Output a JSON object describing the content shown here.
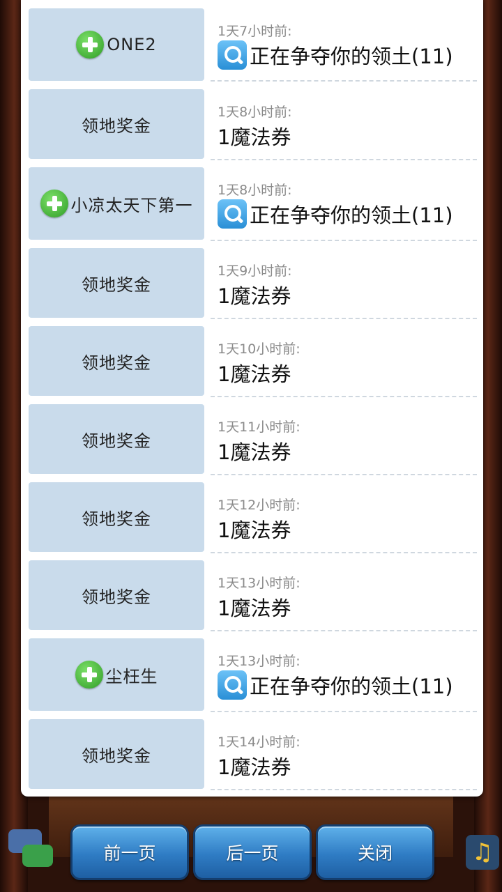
{
  "rows": [
    {
      "left": {
        "icon": "plus-icon",
        "text": "ONE2"
      },
      "time": "1天7小时前:",
      "msg_icon": "search-icon",
      "msg": "正在争夺你的领土(11)"
    },
    {
      "left": {
        "icon": null,
        "text": "领地奖金"
      },
      "time": "1天8小时前:",
      "msg_icon": null,
      "msg": "1魔法券"
    },
    {
      "left": {
        "icon": "plus-icon",
        "text": "小凉太天下第一"
      },
      "time": "1天8小时前:",
      "msg_icon": "search-icon",
      "msg": "正在争夺你的领土(11)"
    },
    {
      "left": {
        "icon": null,
        "text": "领地奖金"
      },
      "time": "1天9小时前:",
      "msg_icon": null,
      "msg": "1魔法券"
    },
    {
      "left": {
        "icon": null,
        "text": "领地奖金"
      },
      "time": "1天10小时前:",
      "msg_icon": null,
      "msg": "1魔法券"
    },
    {
      "left": {
        "icon": null,
        "text": "领地奖金"
      },
      "time": "1天11小时前:",
      "msg_icon": null,
      "msg": "1魔法券"
    },
    {
      "left": {
        "icon": null,
        "text": "领地奖金"
      },
      "time": "1天12小时前:",
      "msg_icon": null,
      "msg": "1魔法券"
    },
    {
      "left": {
        "icon": null,
        "text": "领地奖金"
      },
      "time": "1天13小时前:",
      "msg_icon": null,
      "msg": "1魔法券"
    },
    {
      "left": {
        "icon": "plus-icon",
        "text": "尘枉生"
      },
      "time": "1天13小时前:",
      "msg_icon": "search-icon",
      "msg": "正在争夺你的领土(11)"
    },
    {
      "left": {
        "icon": null,
        "text": "领地奖金"
      },
      "time": "1天14小时前:",
      "msg_icon": null,
      "msg": "1魔法券"
    }
  ],
  "buttons": {
    "prev": "前一页",
    "next": "后一页",
    "close": "关闭"
  },
  "colors": {
    "left_cell_bg": "#c9dbeb",
    "button_blue": "#2f7cc4",
    "plus_green": "#2e9c25",
    "search_blue": "#2a8fd6"
  }
}
